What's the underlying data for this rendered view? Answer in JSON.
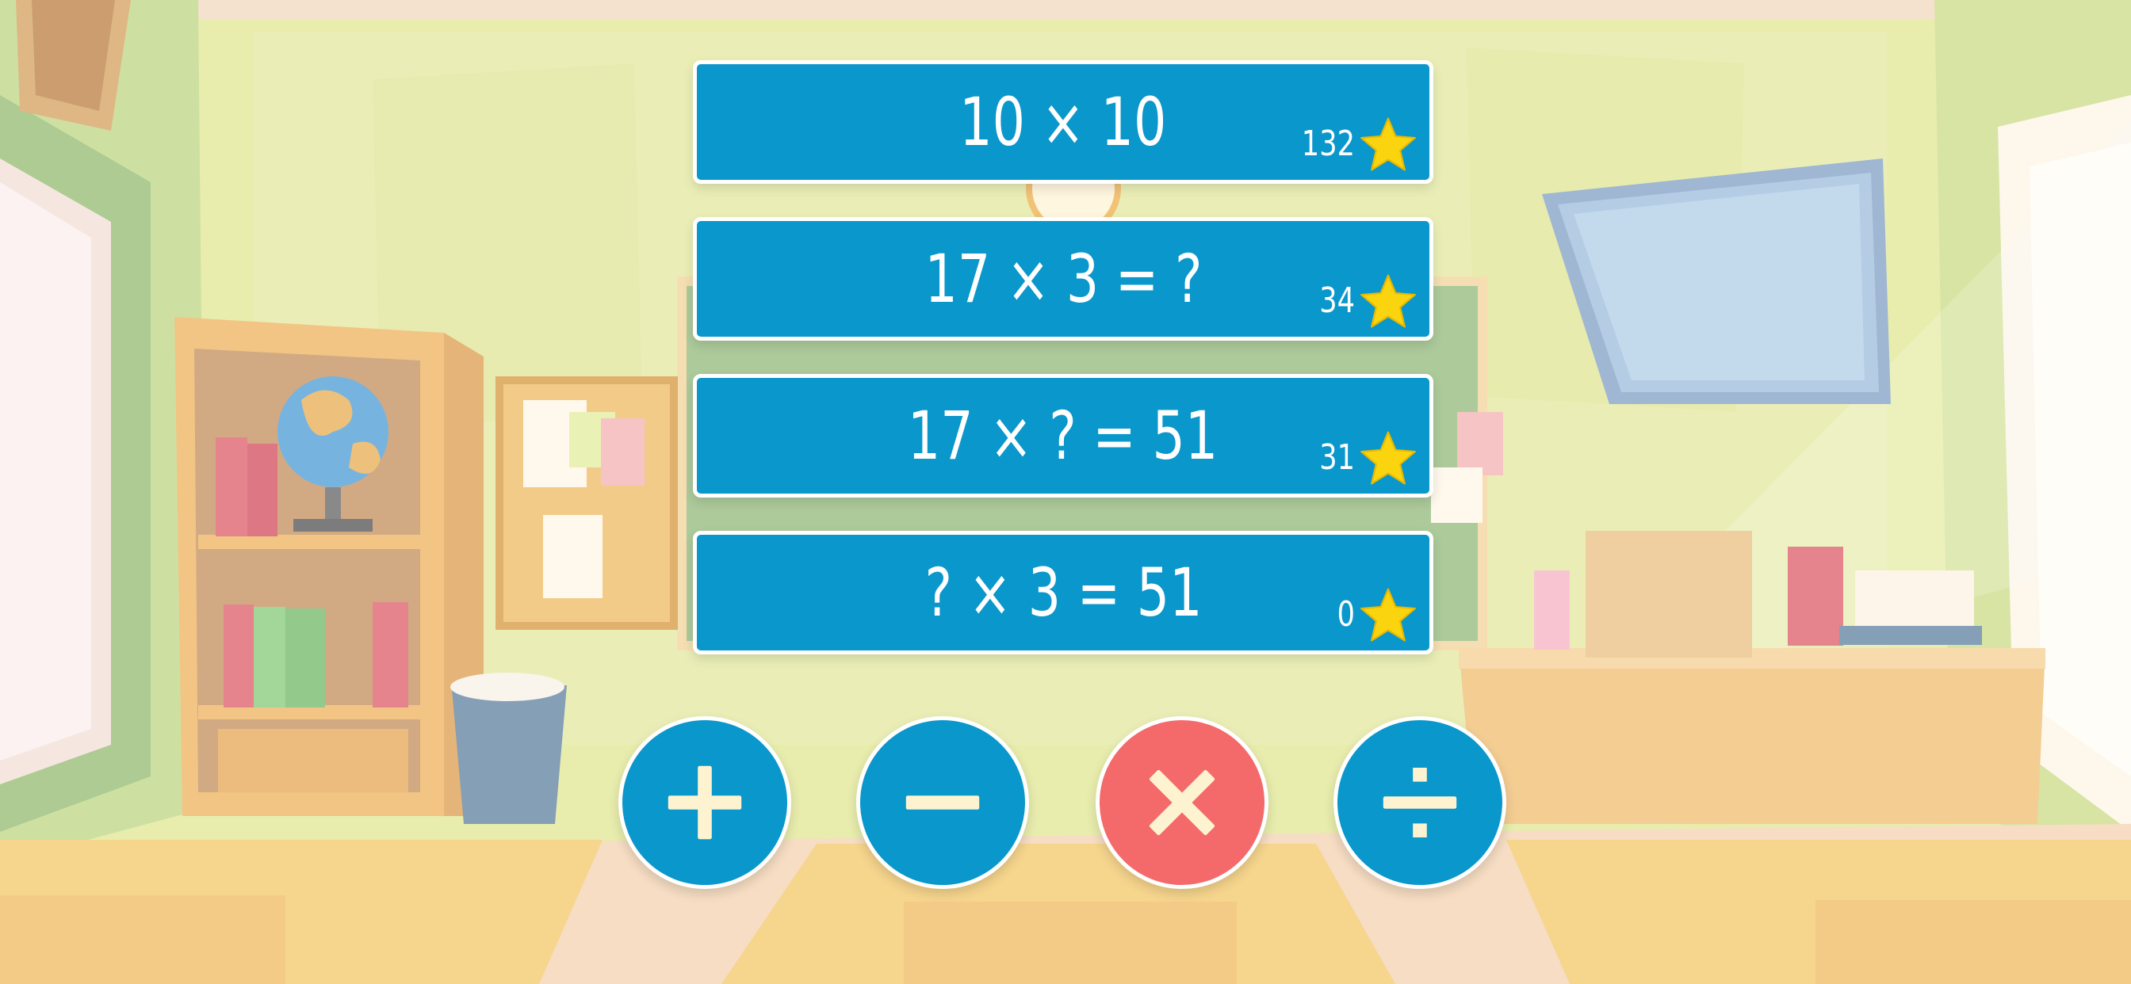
{
  "modes": [
    {
      "label": "10 × 10",
      "score": "132"
    },
    {
      "label": "17 × 3 = ?",
      "score": "34"
    },
    {
      "label": "17 × ? = 51",
      "score": "31"
    },
    {
      "label": "? × 3 = 51",
      "score": "0"
    }
  ],
  "operations": [
    {
      "name": "plus",
      "icon": "plus-icon",
      "selected": false
    },
    {
      "name": "minus",
      "icon": "minus-icon",
      "selected": false
    },
    {
      "name": "multiply",
      "icon": "multiply-icon",
      "selected": true
    },
    {
      "name": "divide",
      "icon": "divide-icon",
      "selected": false
    }
  ],
  "colors": {
    "card": "#0a97cc",
    "selected_operation": "#f46a6a",
    "symbol": "#fdf3d0",
    "star": "#f9d40f"
  }
}
